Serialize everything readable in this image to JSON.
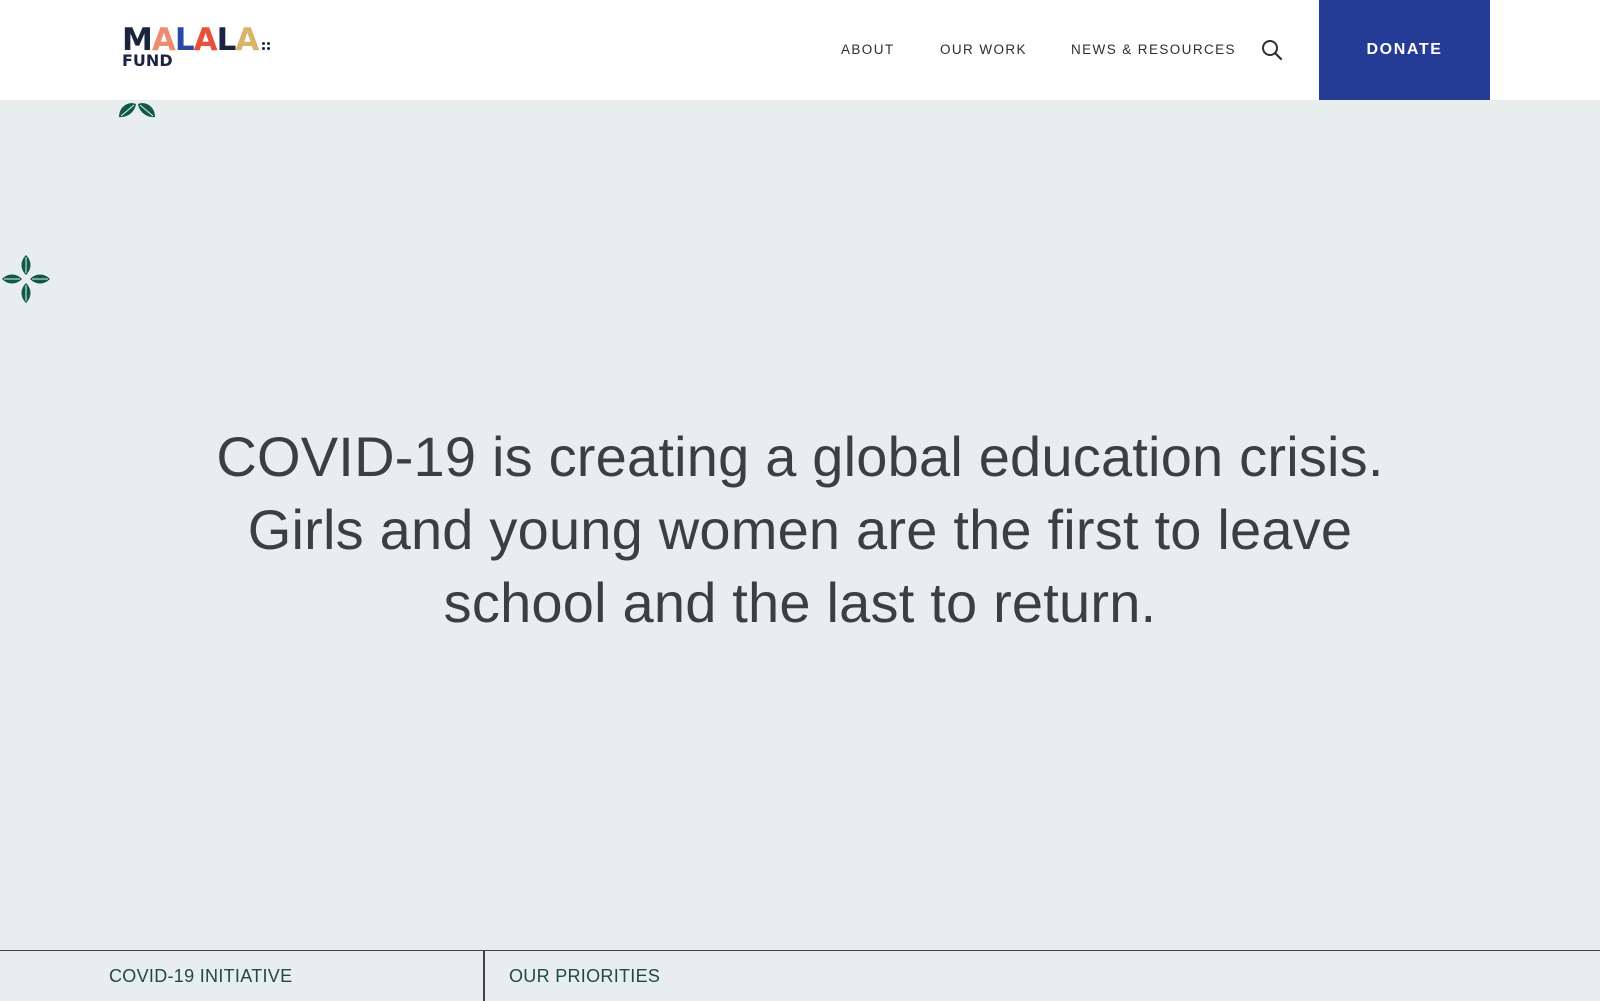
{
  "header": {
    "logo": {
      "letters": [
        "M",
        "A",
        "L",
        "A",
        "L",
        "A"
      ],
      "letter_colors": [
        "#1c2340",
        "#f08c6e",
        "#2c48a6",
        "#e8503a",
        "#1c2340",
        "#d8b56a"
      ],
      "fund": "FUND"
    },
    "nav": {
      "items": [
        {
          "label": "ABOUT"
        },
        {
          "label": "OUR WORK"
        },
        {
          "label": "NEWS & RESOURCES"
        }
      ],
      "search_icon": "search-icon",
      "donate_label": "DONATE"
    }
  },
  "decor": {
    "top_icon": "leaf-pair-icon",
    "left_icon": "flower-icon",
    "color": "#0e5a46"
  },
  "hero": {
    "lines": [
      "COVID-19 is creating a global education crisis.",
      "Girls and young women are the first to leave",
      "school and the last to return."
    ]
  },
  "subnav": {
    "tabs": [
      {
        "label": "COVID-19 INITIATIVE"
      },
      {
        "label": "OUR PRIORITIES"
      }
    ]
  },
  "colors": {
    "donate_bg": "#243c96",
    "page_bg": "#e8edee",
    "subnav_text": "#1f4a44"
  }
}
